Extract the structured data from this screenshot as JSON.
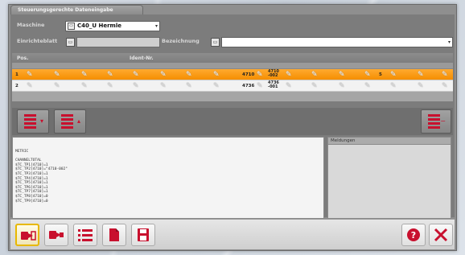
{
  "window": {
    "tab_title": "Steuerungsgerechte Dateneingabe"
  },
  "form": {
    "maschine_label": "Maschine",
    "maschine_value": "C40_U Hermle",
    "einrichteblatt_label": "Einrichteblatt",
    "bezeichnung_label": "Bezeichnung"
  },
  "table": {
    "col_pos": "Pos.",
    "col_ident": "Ident-Nr.",
    "rows": [
      {
        "pos": "1",
        "code": "4710",
        "ident_a": "4710",
        "ident_b": "-002",
        "right": "5"
      },
      {
        "pos": "2",
        "code": "4736",
        "ident_a": "4736",
        "ident_b": "-001",
        "right": ""
      }
    ]
  },
  "code": {
    "lines": [
      "METRIC",
      "",
      "CHANNELTOTAL",
      "$TC_TP1[4710]=1",
      "$TC_TP2[4710]=\"4710-002\"",
      "$TC_TP3[4710]=1",
      "$TC_TP4[4710]=1",
      "$TC_TP5[4710]=1",
      "$TC_TP6[4710]=1",
      "$TC_TP7[4710]=1",
      "$TC_TP8[4710]=0",
      "$TC_TP9[4710]=0"
    ]
  },
  "messages": {
    "title": "Meldungen"
  },
  "colors": {
    "accent": "#f58e00",
    "icon_red": "#c8102e"
  }
}
